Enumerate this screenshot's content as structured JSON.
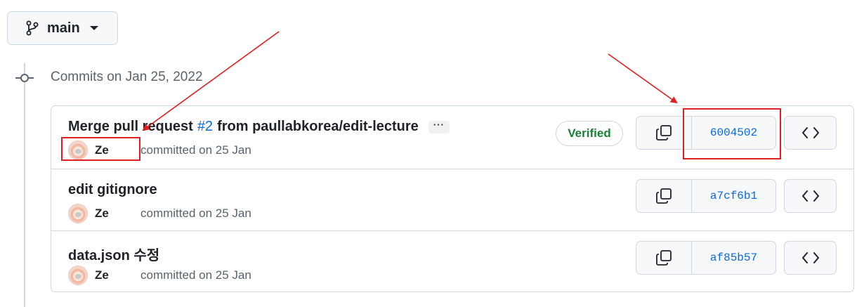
{
  "branch": {
    "name": "main",
    "icon": "git-branch-icon"
  },
  "timeline": {
    "heading": "Commits on Jan 25, 2022",
    "icon": "git-commit-icon"
  },
  "commits": [
    {
      "title_prefix": "Merge pull request",
      "pr_number": "#2",
      "title_suffix": "from paullabkorea/edit-lecture",
      "ellipsis": "···",
      "author": "Ze",
      "committed": "committed on 25 Jan",
      "verified": "Verified",
      "sha": "6004502"
    },
    {
      "title": "edit gitignore",
      "author": "Ze",
      "committed": "committed on 25 Jan",
      "sha": "a7cf6b1"
    },
    {
      "title": "data.json 수정",
      "author": "Ze",
      "committed": "committed on 25 Jan",
      "sha": "af85b57"
    }
  ],
  "colors": {
    "link": "#0969da",
    "verified": "#1a7f37",
    "annotation": "#e02020",
    "border": "#d0d7de",
    "muted": "#59636e"
  }
}
